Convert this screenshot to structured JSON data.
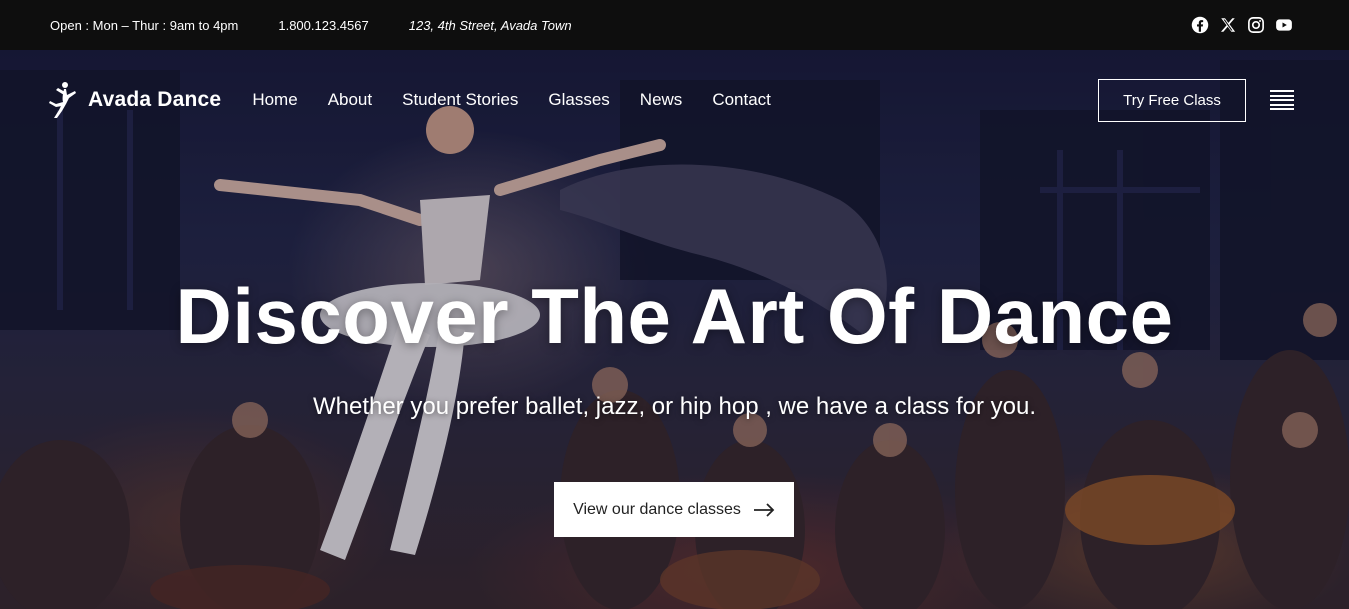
{
  "topbar": {
    "hours": "Open : Mon – Thur : 9am to 4pm",
    "phone": "1.800.123.4567",
    "address": "123, 4th Street, Avada Town",
    "socials": [
      "facebook-icon",
      "x-icon",
      "instagram-icon",
      "youtube-icon"
    ]
  },
  "nav": {
    "brand": "Avada Dance",
    "items": [
      {
        "label": "Home"
      },
      {
        "label": "About"
      },
      {
        "label": "Student Stories"
      },
      {
        "label": "Glasses"
      },
      {
        "label": "News"
      },
      {
        "label": "Contact"
      }
    ],
    "cta": "Try Free Class",
    "menu_icon": "hamburger-icon"
  },
  "hero": {
    "title": "Discover The Art Of Dance",
    "subtitle": "Whether you prefer ballet, jazz, or hip hop , we have a class for you.",
    "button": "View our dance classes",
    "button_icon": "arrow-right-icon"
  },
  "colors": {
    "topbar_bg": "#0e0e0e",
    "text": "#ffffff",
    "button_bg": "#ffffff",
    "button_text": "#222222"
  }
}
